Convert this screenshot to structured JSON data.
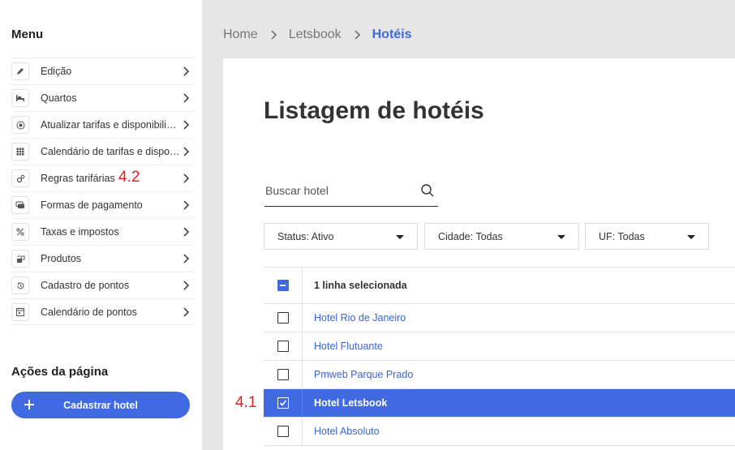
{
  "sidebar": {
    "title": "Menu",
    "items": [
      {
        "label": "Edição",
        "icon": "pencil-icon"
      },
      {
        "label": "Quartos",
        "icon": "bed-icon"
      },
      {
        "label": "Atualizar tarifas e disponibilidade",
        "icon": "target-icon"
      },
      {
        "label": "Calendário de tarifas e disponibilidade",
        "icon": "grid-calendar-icon"
      },
      {
        "label": "Regras tarifárias",
        "icon": "gears-icon"
      },
      {
        "label": "Formas de pagamento",
        "icon": "cards-icon"
      },
      {
        "label": "Taxas e impostos",
        "icon": "percent-icon"
      },
      {
        "label": "Produtos",
        "icon": "products-icon"
      },
      {
        "label": "Cadastro de pontos",
        "icon": "history-icon"
      },
      {
        "label": "Calendário de pontos",
        "icon": "calendar-icon"
      }
    ],
    "actions_title": "Ações da página",
    "primary_button": "Cadastrar hotel"
  },
  "annotations": {
    "a42": "4.2",
    "a41": "4.1"
  },
  "breadcrumb": [
    "Home",
    "Letsbook",
    "Hotéis"
  ],
  "main": {
    "title": "Listagem de hotéis",
    "search_placeholder": "Buscar hotel",
    "filters": [
      "Status: Ativo",
      "Cidade: Todas",
      "UF: Todas"
    ],
    "table_header": "1 linha selecionada",
    "rows": [
      {
        "name": "Hotel Rio de Janeiro",
        "selected": false
      },
      {
        "name": "Hotel Flutuante",
        "selected": false
      },
      {
        "name": "Pmweb Parque Prado",
        "selected": false
      },
      {
        "name": "Hotel Letsbook",
        "selected": true
      },
      {
        "name": "Hotel Absoluto",
        "selected": false
      }
    ]
  },
  "colors": {
    "accent": "#4169e1",
    "annotation": "#e02020"
  }
}
